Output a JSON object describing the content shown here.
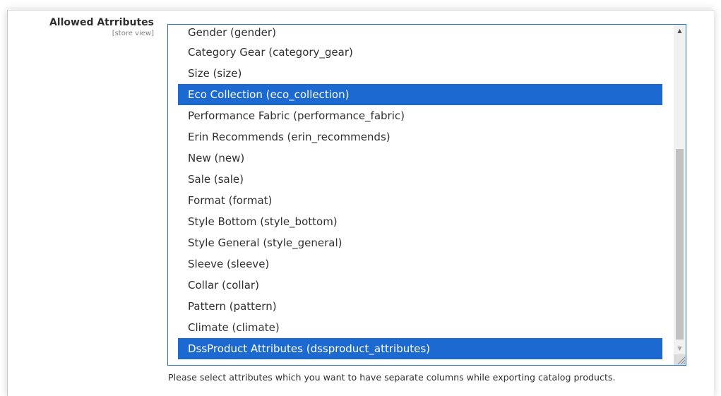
{
  "field": {
    "label": "Allowed Atrributes",
    "scope": "[store view]"
  },
  "options": [
    {
      "label": "Gender (gender)",
      "selected": false
    },
    {
      "label": "Category Gear (category_gear)",
      "selected": false
    },
    {
      "label": "Size (size)",
      "selected": false
    },
    {
      "label": "Eco Collection (eco_collection)",
      "selected": true
    },
    {
      "label": "Performance Fabric (performance_fabric)",
      "selected": false
    },
    {
      "label": "Erin Recommends (erin_recommends)",
      "selected": false
    },
    {
      "label": "New (new)",
      "selected": false
    },
    {
      "label": "Sale (sale)",
      "selected": false
    },
    {
      "label": "Format (format)",
      "selected": false
    },
    {
      "label": "Style Bottom (style_bottom)",
      "selected": false
    },
    {
      "label": "Style General (style_general)",
      "selected": false
    },
    {
      "label": "Sleeve (sleeve)",
      "selected": false
    },
    {
      "label": "Collar (collar)",
      "selected": false
    },
    {
      "label": "Pattern (pattern)",
      "selected": false
    },
    {
      "label": "Climate (climate)",
      "selected": false
    },
    {
      "label": "DssProduct Attributes (dssproduct_attributes)",
      "selected": true
    }
  ],
  "note": "Please select attributes which you want to have separate columns while exporting catalog products.",
  "icons": {
    "scroll_up": "triangle-up",
    "scroll_down": "triangle-down",
    "resize": "resize-grip"
  },
  "colors": {
    "selected_bg": "#1c6ad1",
    "focus_border": "#1f75cc"
  }
}
